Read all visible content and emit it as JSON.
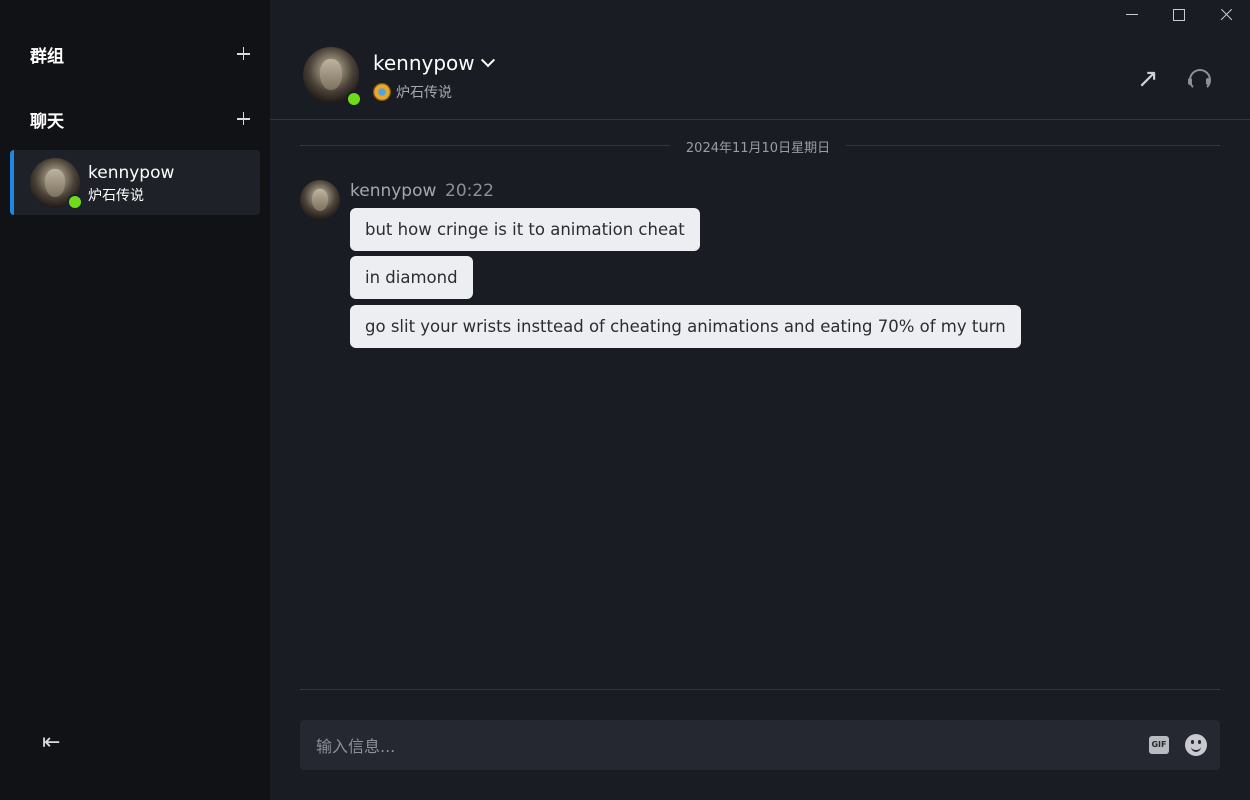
{
  "sidebar": {
    "groups_label": "群组",
    "chats_label": "聊天",
    "chats": [
      {
        "name": "kennypow",
        "game": "炉石传说",
        "status": "online"
      }
    ]
  },
  "header": {
    "name": "kennypow",
    "game": "炉石传说",
    "status": "online"
  },
  "conversation": {
    "date_separator": "2024年11月10日星期日",
    "messages": [
      {
        "author": "kennypow",
        "time": "20:22",
        "lines": [
          "but how cringe is it to animation cheat",
          "in diamond",
          "go slit your wrists insttead of cheating animations and eating 70% of my turn"
        ]
      }
    ]
  },
  "composer": {
    "placeholder": "输入信息...",
    "value": "",
    "gif_label": "GIF"
  },
  "colors": {
    "accent": "#1e88e5",
    "online": "#6fdc1b",
    "background": "#1a1c23",
    "sidebar": "#111216",
    "bubble": "#eceef1"
  },
  "icons": {
    "add": "plus-icon",
    "collapse": "collapse-sidebar-icon",
    "popout": "popout-arrow-icon",
    "voice": "headset-icon",
    "gif": "gif-icon",
    "emoji": "emoji-icon"
  }
}
